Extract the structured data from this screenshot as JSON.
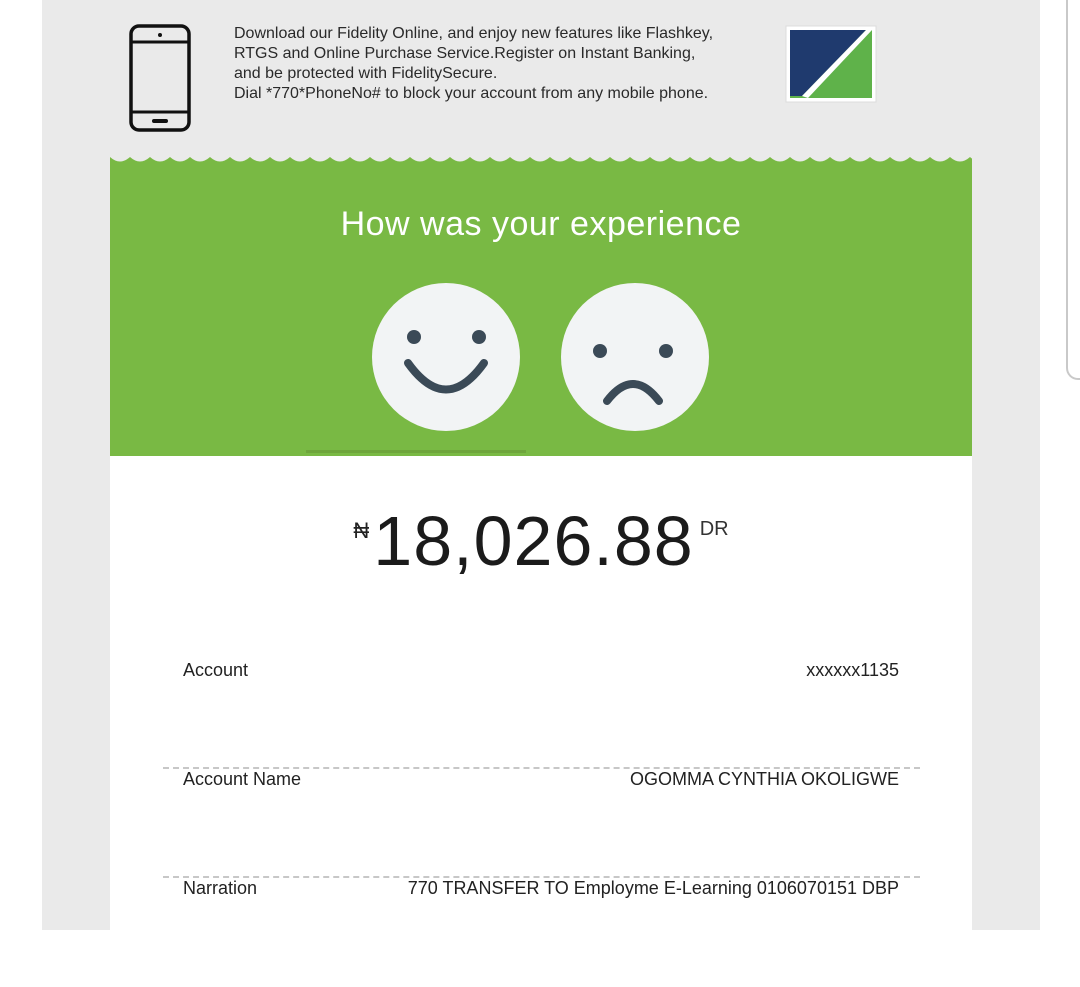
{
  "promo": {
    "lines": [
      "Download our Fidelity Online, and enjoy new features like Flashkey,",
      "RTGS and Online Purchase Service.Register on Instant Banking,",
      "and be protected with FidelitySecure.",
      "Dial *770*PhoneNo# to block your account from any mobile phone."
    ],
    "phone_icon": "mobile-phone-icon",
    "logo_colors": {
      "navy": "#1f3a6e",
      "green": "#5fb24a"
    }
  },
  "feedback": {
    "title": "How was your experience",
    "background": "#79b944",
    "options": [
      {
        "icon": "happy-face-icon"
      },
      {
        "icon": "sad-face-icon"
      }
    ]
  },
  "transaction": {
    "currency_symbol": "₦",
    "amount": "18,026.88",
    "type": "DR",
    "details": [
      {
        "label": "Account",
        "value": "xxxxxx1135"
      },
      {
        "label": "Account Name",
        "value": "OGOMMA CYNTHIA OKOLIGWE"
      },
      {
        "label": "Narration",
        "value": "770 TRANSFER TO Employme E-Learning 0106070151 DBP"
      }
    ]
  }
}
